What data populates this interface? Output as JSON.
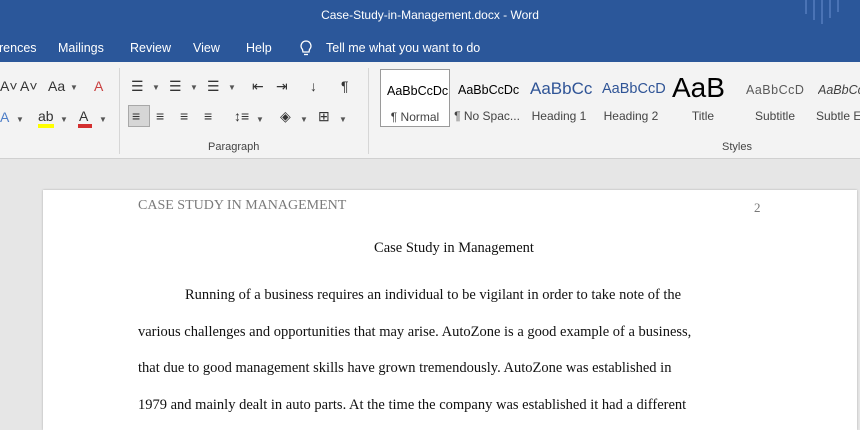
{
  "window": {
    "title": "Case-Study-in-Management.docx  -  Word"
  },
  "tabs": [
    "rences",
    "Mailings",
    "Review",
    "View",
    "Help"
  ],
  "tell_me": "Tell me what you want to do",
  "groups": {
    "paragraph": "Paragraph",
    "styles": "Styles"
  },
  "styles": [
    {
      "preview": "AaBbCcDc",
      "name": "¶ Normal"
    },
    {
      "preview": "AaBbCcDc",
      "name": "¶ No Spac..."
    },
    {
      "preview": "AaBbCc",
      "name": "Heading 1"
    },
    {
      "preview": "AaBbCcD",
      "name": "Heading 2"
    },
    {
      "preview": "AaB",
      "name": "Title"
    },
    {
      "preview": "AaBbCcD",
      "name": "Subtitle"
    },
    {
      "preview": "AaBbCcl",
      "name": "Subtle En"
    }
  ],
  "document": {
    "header": "CASE STUDY IN MANAGEMENT",
    "page_number": "2",
    "title": "Case Study in Management",
    "lines": [
      "Running of a business requires an individual to be vigilant in order to take note of the",
      "various challenges and opportunities that may arise. AutoZone is a good example of a business,",
      "that due to good management skills have grown tremendously. AutoZone was established in",
      "1979 and mainly dealt in auto parts. At the time the company was established it had a different"
    ]
  },
  "colors": {
    "brand": "#2b579a",
    "ribbon": "#f3f3f3",
    "heading": "#2f5496"
  }
}
